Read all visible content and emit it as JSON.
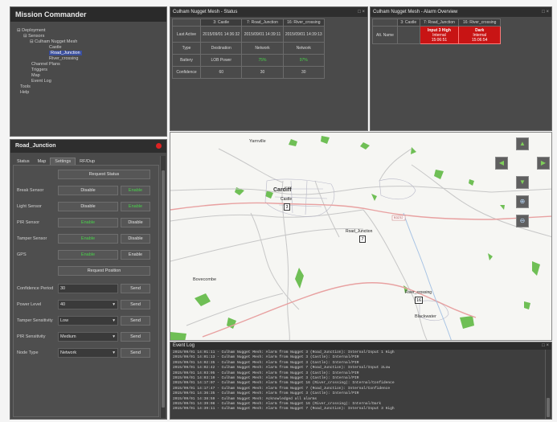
{
  "app": {
    "title": "Mission Commander"
  },
  "tree": {
    "items": [
      {
        "label": "Deployment",
        "level": 0
      },
      {
        "label": "Sensors",
        "level": 1
      },
      {
        "label": "Culham Nugget Mesh",
        "level": 2
      },
      {
        "label": "Castle",
        "level": 3
      },
      {
        "label": "Road_Junction",
        "level": 3,
        "selected": true
      },
      {
        "label": "River_crossing",
        "level": 3
      },
      {
        "label": "Channel Plans",
        "level": 1
      },
      {
        "label": "Triggers",
        "level": 1
      },
      {
        "label": "Map",
        "level": 1
      },
      {
        "label": "Event Log",
        "level": 1
      },
      {
        "label": "Tools",
        "level": 0
      },
      {
        "label": "Help",
        "level": 0
      }
    ]
  },
  "status_panel": {
    "title": "Culham Nugget Mesh - Status",
    "columns": [
      "3: Castle",
      "7: Road_Junction",
      "16: River_crossing"
    ],
    "rows": [
      {
        "label": "Last Active",
        "values": [
          "2015/09/01 14:36:32",
          "2015/09/01 14:39:11",
          "2015/09/01 14:39:13"
        ],
        "green": [
          false,
          false,
          false
        ]
      },
      {
        "label": "Type",
        "values": [
          "Destination",
          "Network",
          "Network"
        ],
        "green": [
          false,
          false,
          false
        ]
      },
      {
        "label": "Battery",
        "values": [
          "LOB Power",
          "75%",
          "97%"
        ],
        "green": [
          false,
          true,
          true
        ]
      },
      {
        "label": "Confidence",
        "values": [
          "60",
          "30",
          "30"
        ],
        "green": [
          false,
          false,
          false
        ]
      }
    ]
  },
  "alarm_panel": {
    "title": "Culham Nugget Mesh - Alarm Overview",
    "columns": [
      "3: Castle",
      "7: Road_Junction",
      "16: River_crossing"
    ],
    "row_label": "Alt. Name",
    "cells": [
      {
        "text": "",
        "alarm": false
      },
      {
        "line1": "Input 3 High",
        "line2": "Internal",
        "line3": "15:06:51",
        "alarm": true
      },
      {
        "line1": "Dark",
        "line2": "Internal",
        "line3": "15:06:54",
        "alarm": true
      }
    ]
  },
  "control": {
    "title": "Road_Junction",
    "tabs": [
      "Status",
      "Map",
      "Settings",
      "RF/Dup"
    ],
    "active_tab": "Settings",
    "request_status": "Request Status",
    "rows": [
      {
        "label": "Break Sensor",
        "left": "Disable",
        "right": "Enable",
        "left_green": false,
        "right_green": true
      },
      {
        "label": "Light Sensor",
        "left": "Disable",
        "right": "Enable",
        "left_green": false,
        "right_green": true
      },
      {
        "label": "PIR Sensor",
        "left": "Enable",
        "right": "Disable",
        "left_green": true,
        "right_green": false
      },
      {
        "label": "Tamper Sensor",
        "left": "Enable",
        "right": "Disable",
        "left_green": true,
        "right_green": false
      },
      {
        "label": "GPS",
        "left": "Enable",
        "right": "Enable",
        "left_green": true,
        "right_green": false
      }
    ],
    "request_position": "Request Position",
    "settings": [
      {
        "label": "Confidence Period",
        "value": "30",
        "has_dropdown": false,
        "send": "Send"
      },
      {
        "label": "Power Level",
        "value": "40",
        "has_dropdown": true,
        "send": "Send"
      },
      {
        "label": "Tamper Sensitivity",
        "value": "Low",
        "has_dropdown": true,
        "send": "Send"
      },
      {
        "label": "PIR Sensitivity",
        "value": "Medium",
        "has_dropdown": true,
        "send": "Send"
      },
      {
        "label": "Node Type",
        "value": "Network",
        "has_dropdown": true,
        "send": "Send"
      }
    ]
  },
  "map": {
    "towns": [
      "Yarnville",
      "Cardiff",
      "Castle",
      "Road_Junction",
      "Bovecombe",
      "River_crossing",
      "Blackwater"
    ],
    "nodes": [
      {
        "label": "Castle",
        "id": "3"
      },
      {
        "label": "Road_Junction",
        "id": "7"
      },
      {
        "label": "River_crossing",
        "id": "16"
      }
    ],
    "road_label": "B3232",
    "buttons": [
      "pan-up",
      "pan-left",
      "pan-right",
      "pan-down",
      "zoom-in",
      "zoom-out"
    ]
  },
  "event_log": {
    "title": "Event Log",
    "lines": [
      "2015/09/01 14:01:11 - Culham Nugget Mesh: Alarm from Nugget 3 (Road_Junction): Internal/Input 1 High",
      "2015/09/01 14:01:13 - Culham Nugget Mesh: Alarm from Nugget 3 (Castle): Internal/PIR",
      "2015/09/01 14:02:35 - Culham Nugget Mesh: Alarm from Nugget 3 (Castle): Internal/PIR",
      "2015/09/01 14:02:42 - Culham Nugget Mesh: Alarm from Nugget 7 (Road_Junction): Internal/Input 2Low",
      "2015/09/01 14:03:05 - Culham Nugget Mesh: Alarm from Nugget 3 (Castle): Internal/PIR",
      "2015/09/01 14:03:10 - Culham Nugget Mesh: Alarm from Nugget 3 (Castle): Internal/PIR",
      "2015/09/01 14:17:07 - Culham Nugget Mesh: Alarm from Nugget 16 (River_crossing): Internal/Confidence",
      "2015/09/01 14:17:47 - Culham Nugget Mesh: Alarm from Nugget 7 (Road_Junction): Internal/Confidence",
      "2015/09/01 14:36:35 - Culham Nugget Mesh: Alarm from Nugget 3 (Castle): Internal/PIR",
      "2015/09/01 14:38:59 - Culham Nugget Mesh: Acknowledged all alarms",
      "2015/09/01 14:39:08 - Culham Nugget Mesh: Alarm from Nugget 16 (River_crossing): Internal/Dark",
      "2015/09/01 14:39:11 - Culham Nugget Mesh: Alarm from Nugget 7 (Road_Junction): Internal/Input 3 High"
    ]
  }
}
